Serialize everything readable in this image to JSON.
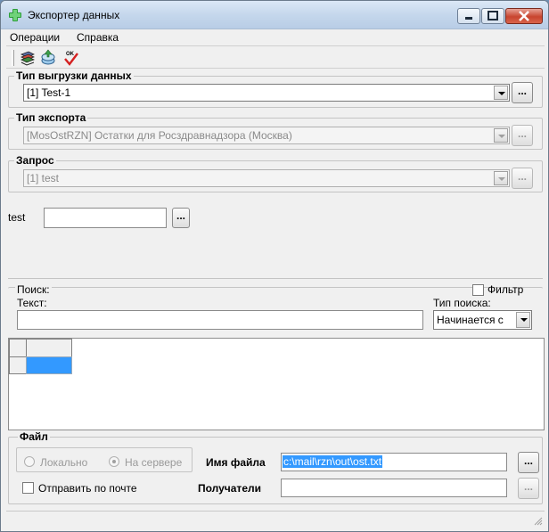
{
  "window": {
    "title": "Экспортер данных"
  },
  "menu": {
    "items": [
      "Операции",
      "Справка"
    ]
  },
  "toolbar": {
    "icons": [
      "books-icon",
      "save-disk-icon",
      "ok-check-icon"
    ]
  },
  "export_data_type": {
    "title": "Тип выгрузки данных",
    "value": "[1] Test-1",
    "button": "..."
  },
  "export_type": {
    "title": "Тип экспорта",
    "value": "[MosOstRZN] Остатки для Росздравнадзора (Москва)",
    "button": "..."
  },
  "query": {
    "title": "Запрос",
    "value": "[1] test",
    "button": "..."
  },
  "param": {
    "label": "test",
    "value": "",
    "button": "..."
  },
  "search": {
    "title": "Поиск:",
    "filter_label": "Фильтр",
    "filter_checked": false,
    "text_label": "Текст:",
    "text_value": "",
    "type_label": "Тип поиска:",
    "type_value": "Начинается с"
  },
  "file": {
    "title": "Файл",
    "local_label": "Локально",
    "server_label": "На сервере",
    "name_label": "Имя файла",
    "name_value": "c:\\mail\\rzn\\out\\ost.txt",
    "name_button": "...",
    "email_label": "Отправить по почте",
    "recipients_label": "Получатели",
    "recipients_value": "",
    "recipients_button": "..."
  },
  "colors": {
    "selection": "#3399ff",
    "window_bg": "#f0f0f0"
  }
}
